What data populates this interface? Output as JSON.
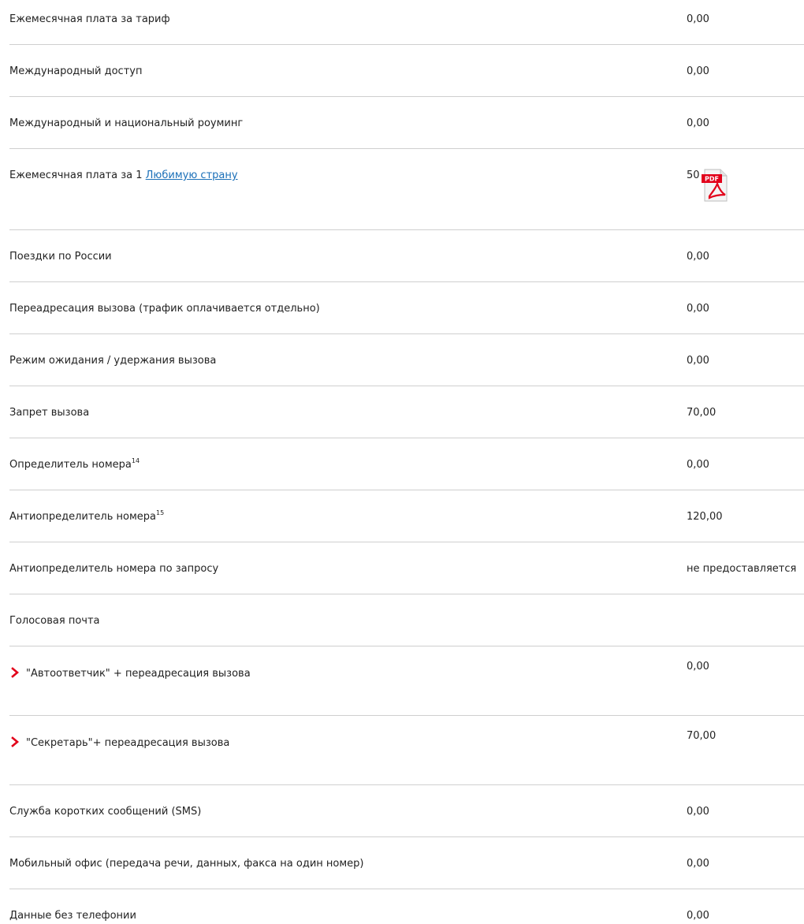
{
  "rows": [
    {
      "label": "Ежемесячная плата за тариф",
      "value": "0,00"
    },
    {
      "label": "Международный доступ",
      "value": "0,00"
    },
    {
      "label": "Международный и национальный роуминг",
      "value": "0,00"
    },
    {
      "label_prefix": "Ежемесячная плата за 1 ",
      "link": "Любимую страну",
      "value": "50"
    },
    {
      "label": "Поездки по России",
      "value": "0,00"
    },
    {
      "label": "Переадресация вызова (трафик оплачивается отдельно)",
      "value": "0,00"
    },
    {
      "label": "Режим ожидания / удержания вызова",
      "value": "0,00"
    },
    {
      "label": "Запрет вызова",
      "value": "70,00"
    },
    {
      "label": "Определитель номера",
      "sup": "14",
      "value": "0,00"
    },
    {
      "label": "Антиопределитель номера",
      "sup": "15",
      "value": "120,00"
    },
    {
      "label": "Антиопределитель номера по запросу",
      "value": "не предоставляется"
    },
    {
      "label": "Голосовая почта",
      "value": ""
    },
    {
      "label": "\"Автоответчик\" + переадресация вызова",
      "value": "0,00"
    },
    {
      "label": "\"Секретарь\"+ переадресация вызова",
      "value": "70,00"
    },
    {
      "label": "Служба коротких сообщений (SMS)",
      "value": "0,00"
    },
    {
      "label": "Мобильный офис (передача речи, данных, факса на один номер)",
      "value": "0,00"
    },
    {
      "label": "Данные без телефонии",
      "value": "0,00"
    }
  ],
  "icons": {
    "pdf": "pdf-icon",
    "bullet": "chevron-right-icon"
  },
  "pdf_icon_text": "PDF",
  "colors": {
    "link": "#1a6fb8",
    "accent": "#e2001a",
    "divider": "#cfcfcf"
  }
}
